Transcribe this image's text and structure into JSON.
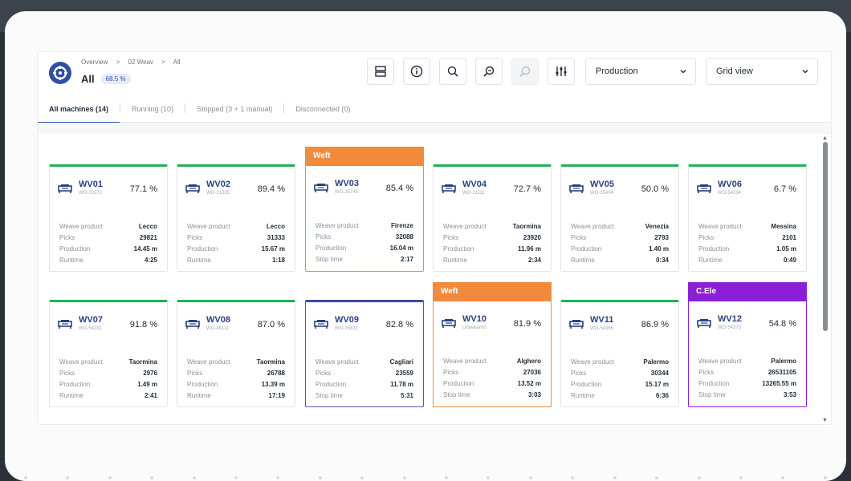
{
  "header": {
    "breadcrumbs": [
      "Overview",
      ">",
      "02 Weav",
      ">",
      "All"
    ],
    "title": "All",
    "efficiency_badge": "68.5 %",
    "production_select": "Production",
    "view_select": "Grid view"
  },
  "tabs": [
    {
      "label": "All machines (14)"
    },
    {
      "label": "Running (10)"
    },
    {
      "label": "Stopped (3 + 1 manual)"
    },
    {
      "label": "Disconnected (0)"
    }
  ],
  "colors": {
    "running": "#1fb25a",
    "weft": "#f28a3c",
    "cele": "#8b1fd6",
    "blue": "#3f4aa5",
    "brand": "#2e4fa3"
  },
  "machines": [
    {
      "name": "WV01",
      "order": "WO-20372",
      "pct": "77.1 %",
      "banner": "",
      "status": "running",
      "rows": [
        [
          "Weave product",
          "Lecco"
        ],
        [
          "Picks",
          "29821"
        ],
        [
          "Production",
          "14.45 m"
        ],
        [
          "Runtime",
          "4:25"
        ]
      ]
    },
    {
      "name": "WV02",
      "order": "WO-21335",
      "pct": "89.4 %",
      "banner": "",
      "status": "running",
      "rows": [
        [
          "Weave product",
          "Lecco"
        ],
        [
          "Picks",
          "31333"
        ],
        [
          "Production",
          "15.67 m"
        ],
        [
          "Runtime",
          "1:18"
        ]
      ]
    },
    {
      "name": "WV03",
      "order": "WO-35745",
      "pct": "85.4 %",
      "banner": "Weft",
      "status": "weft",
      "rows": [
        [
          "Weave product",
          "Firenze"
        ],
        [
          "Picks",
          "32088"
        ],
        [
          "Production",
          "16.04 m"
        ],
        [
          "Stop time",
          "2:17"
        ]
      ]
    },
    {
      "name": "WV04",
      "order": "WO-21111",
      "pct": "72.7 %",
      "banner": "",
      "status": "running",
      "rows": [
        [
          "Weave product",
          "Taormina"
        ],
        [
          "Picks",
          "23920"
        ],
        [
          "Production",
          "11.96 m"
        ],
        [
          "Runtime",
          "2:34"
        ]
      ]
    },
    {
      "name": "WV05",
      "order": "WO-15404",
      "pct": "50.0 %",
      "banner": "",
      "status": "running",
      "rows": [
        [
          "Weave product",
          "Venezia"
        ],
        [
          "Picks",
          "2793"
        ],
        [
          "Production",
          "1.40 m"
        ],
        [
          "Runtime",
          "0:34"
        ]
      ]
    },
    {
      "name": "WV06",
      "order": "WO-54334",
      "pct": "6.7 %",
      "banner": "",
      "status": "running",
      "rows": [
        [
          "Weave product",
          "Messina"
        ],
        [
          "Picks",
          "2101"
        ],
        [
          "Production",
          "1.05 m"
        ],
        [
          "Runtime",
          "0:49"
        ]
      ]
    },
    {
      "name": "WV07",
      "order": "WO-54391",
      "pct": "91.8 %",
      "banner": "",
      "status": "running",
      "rows": [
        [
          "Weave product",
          "Taormina"
        ],
        [
          "Picks",
          "2976"
        ],
        [
          "Production",
          "1.49 m"
        ],
        [
          "Runtime",
          "2:41"
        ]
      ]
    },
    {
      "name": "WV08",
      "order": "WO-46111",
      "pct": "87.0 %",
      "banner": "",
      "status": "running",
      "rows": [
        [
          "Weave product",
          "Taormina"
        ],
        [
          "Picks",
          "26788"
        ],
        [
          "Production",
          "13.39 m"
        ],
        [
          "Runtime",
          "17:19"
        ]
      ]
    },
    {
      "name": "WV09",
      "order": "WO-35811",
      "pct": "82.8 %",
      "banner": "",
      "status": "blue",
      "rows": [
        [
          "Weave product",
          "Cagliari"
        ],
        [
          "Picks",
          "23559"
        ],
        [
          "Production",
          "11.78 m"
        ],
        [
          "Stop time",
          "5:31"
        ]
      ]
    },
    {
      "name": "WV10",
      "order": "Unbekannt",
      "pct": "81.9 %",
      "banner": "Weft",
      "status": "weft",
      "rows": [
        [
          "Weave product",
          "Alghero"
        ],
        [
          "Picks",
          "27036"
        ],
        [
          "Production",
          "13.52 m"
        ],
        [
          "Stop time",
          "3:03"
        ]
      ]
    },
    {
      "name": "WV11",
      "order": "WO-54366",
      "pct": "86.9 %",
      "banner": "",
      "status": "running",
      "rows": [
        [
          "Weave product",
          "Palermo"
        ],
        [
          "Picks",
          "30344"
        ],
        [
          "Production",
          "15.17 m"
        ],
        [
          "Runtime",
          "6:36"
        ]
      ]
    },
    {
      "name": "WV12",
      "order": "WO-54373",
      "pct": "54.8 %",
      "banner": "C.Ele",
      "status": "cele",
      "rows": [
        [
          "Weave product",
          "Palermo"
        ],
        [
          "Picks",
          "26531105"
        ],
        [
          "Production",
          "13265.55 m"
        ],
        [
          "Stop time",
          "3:53"
        ]
      ]
    }
  ]
}
